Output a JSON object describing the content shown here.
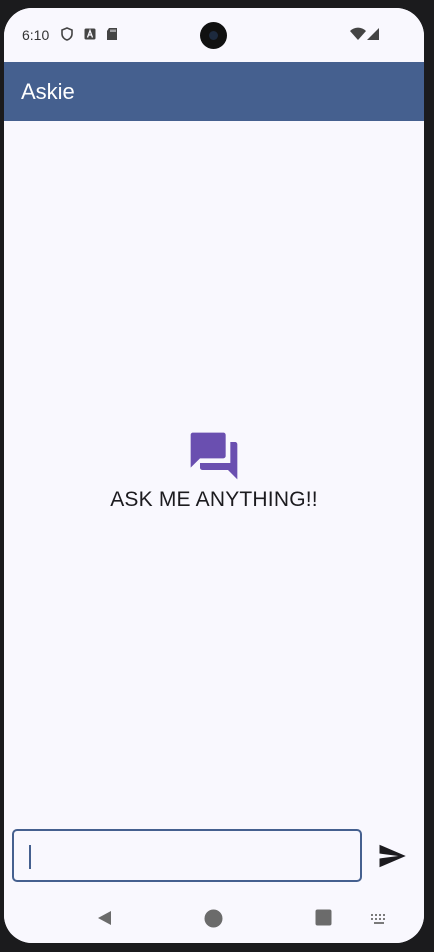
{
  "status_bar": {
    "time": "6:10",
    "icons": [
      "shield-icon",
      "a-badge-icon",
      "sd-card-icon",
      "wifi-icon",
      "signal-icon"
    ]
  },
  "app_bar": {
    "title": "Askie",
    "color": "#45608f"
  },
  "empty_state": {
    "icon": "forum-icon",
    "icon_color": "#6a4fb0",
    "text": "ASK ME ANYTHING!!"
  },
  "composer": {
    "value": "",
    "placeholder": "",
    "send_icon": "send-icon"
  },
  "nav_bar": {
    "buttons": [
      "back-icon",
      "home-icon",
      "recents-icon",
      "keyboard-icon"
    ]
  }
}
